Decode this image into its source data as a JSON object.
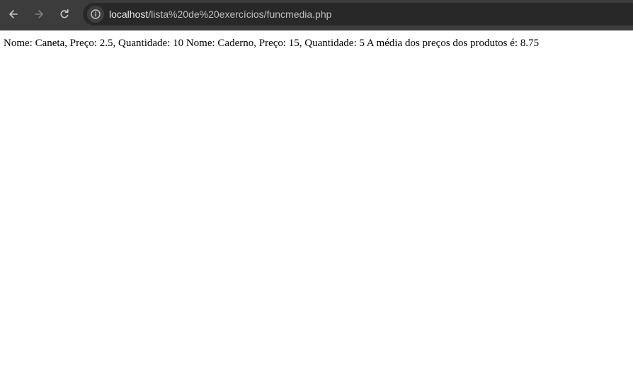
{
  "browser": {
    "url_host": "localhost",
    "url_path": "/lista%20de%20exercícios/funcmedia.php",
    "icons": {
      "back": "arrow-left-icon",
      "forward": "arrow-right-icon",
      "reload": "reload-icon",
      "site_info": "info-icon"
    },
    "colors": {
      "toolbar": "#3c3c3c",
      "omnibox": "#282828"
    }
  },
  "page": {
    "output_text": "Nome: Caneta, Preço: 2.5, Quantidade: 10 Nome: Caderno, Preço: 15, Quantidade: 5 A média dos preços dos produtos é: 8.75"
  }
}
